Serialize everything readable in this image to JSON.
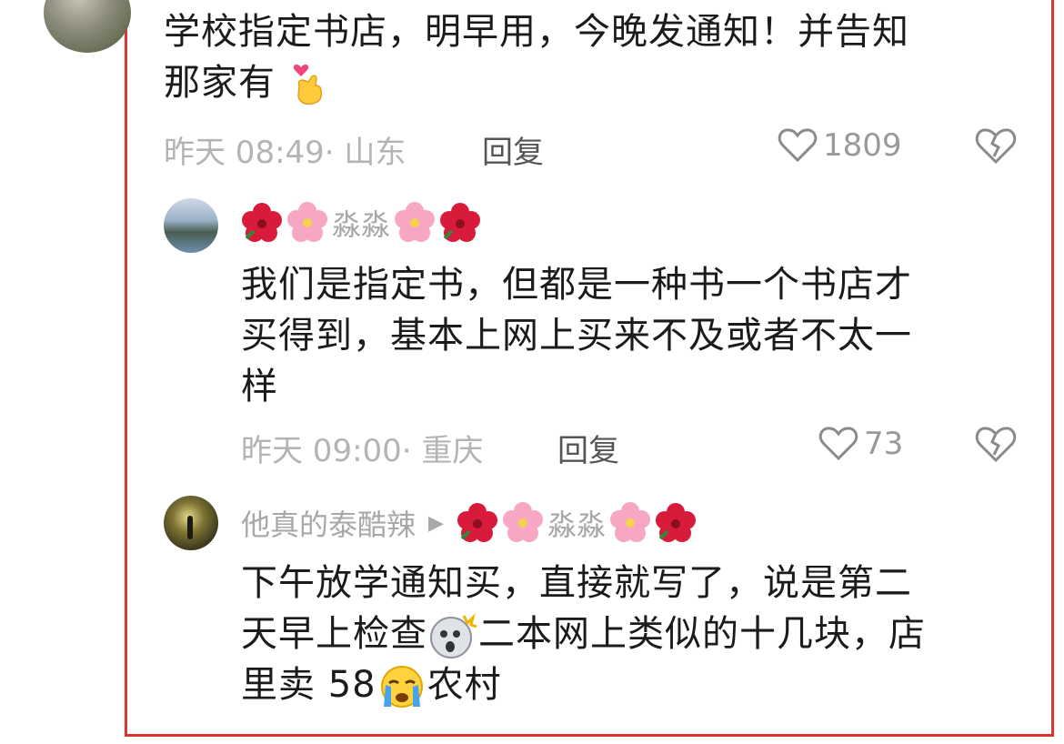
{
  "comment": {
    "text_line1": "学校指定书店，明早用，今晚发通知！并告知",
    "text_line2": "那家有",
    "emoji": "hand-heart-emoji",
    "time": "昨天 08:49",
    "location": "· 山东",
    "reply_label": "回复",
    "likes": "1809"
  },
  "reply1": {
    "username": "淼淼",
    "text_line1": "我们是指定书，但都是一种书一个书店才",
    "text_line2": "买得到，基本上网上买来不及或者不太一",
    "text_line3": "样",
    "time": "昨天 09:00",
    "location": "· 重庆",
    "reply_label": "回复",
    "likes": "73"
  },
  "reply2": {
    "username": "他真的泰酷辣",
    "reply_to": "淼淼",
    "text_line1": "下午放学通知买，直接就写了，说是第二",
    "text_line2a": "天早上检查",
    "text_line2b": "二本网上类似的十几块，店",
    "text_line3a": "里卖 58",
    "text_line3b": "农村"
  },
  "colors": {
    "frame": "#e0332f",
    "meta": "#b4b4b4",
    "text": "#1b1b1b"
  }
}
